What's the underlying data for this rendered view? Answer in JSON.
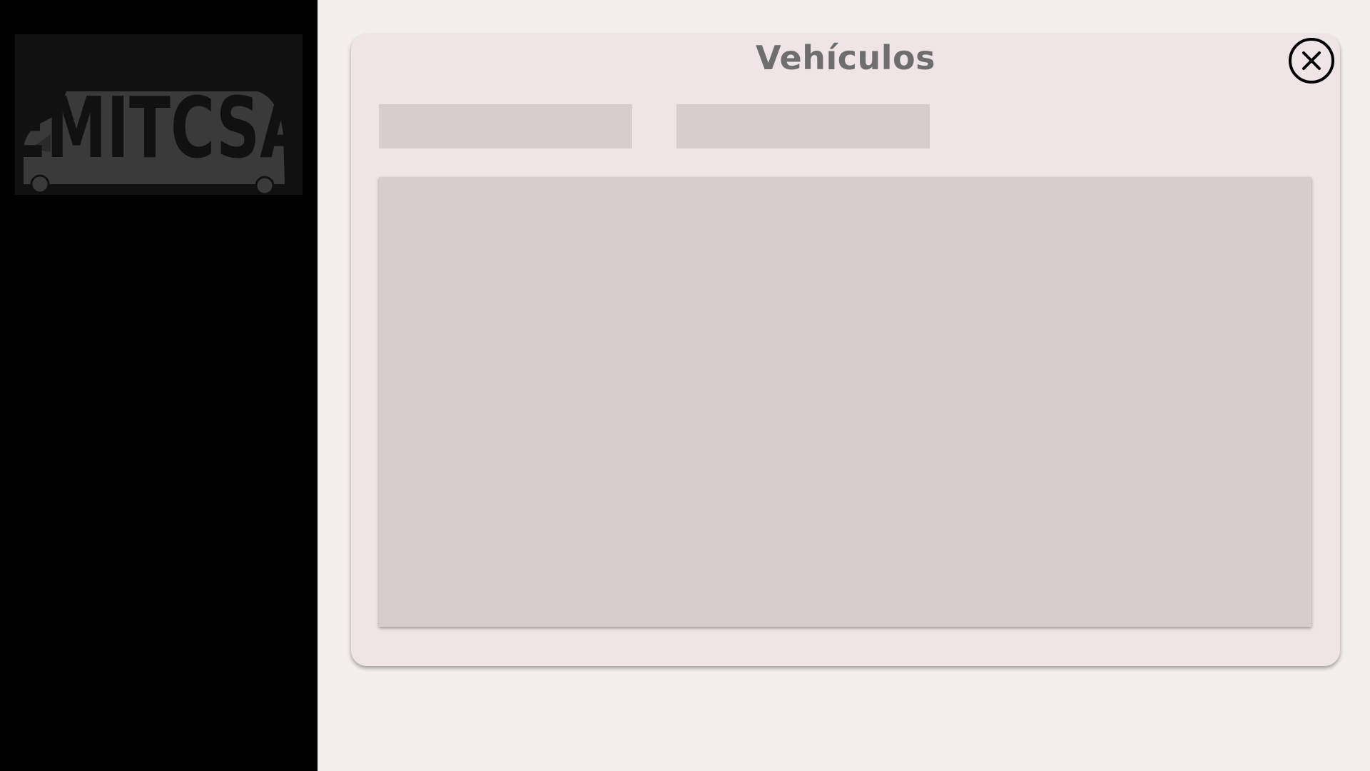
{
  "sidebar": {
    "logo": {
      "text": "EMITCSA",
      "icon": "van-logo-icon"
    }
  },
  "dialog": {
    "title": "Vehículos",
    "close_icon": "close-icon",
    "filters": [
      {
        "value": ""
      },
      {
        "value": ""
      }
    ],
    "grid": {
      "rows": []
    }
  },
  "colors": {
    "sidebar_bg": "#000000",
    "logo_bg": "#111111",
    "logo_fg": "#3a3a3a",
    "page_bg": "#f4eeee",
    "panel_bg": "#efe5e6",
    "field_bg": "#d7cdcf",
    "title_color": "#6e6e6e"
  }
}
